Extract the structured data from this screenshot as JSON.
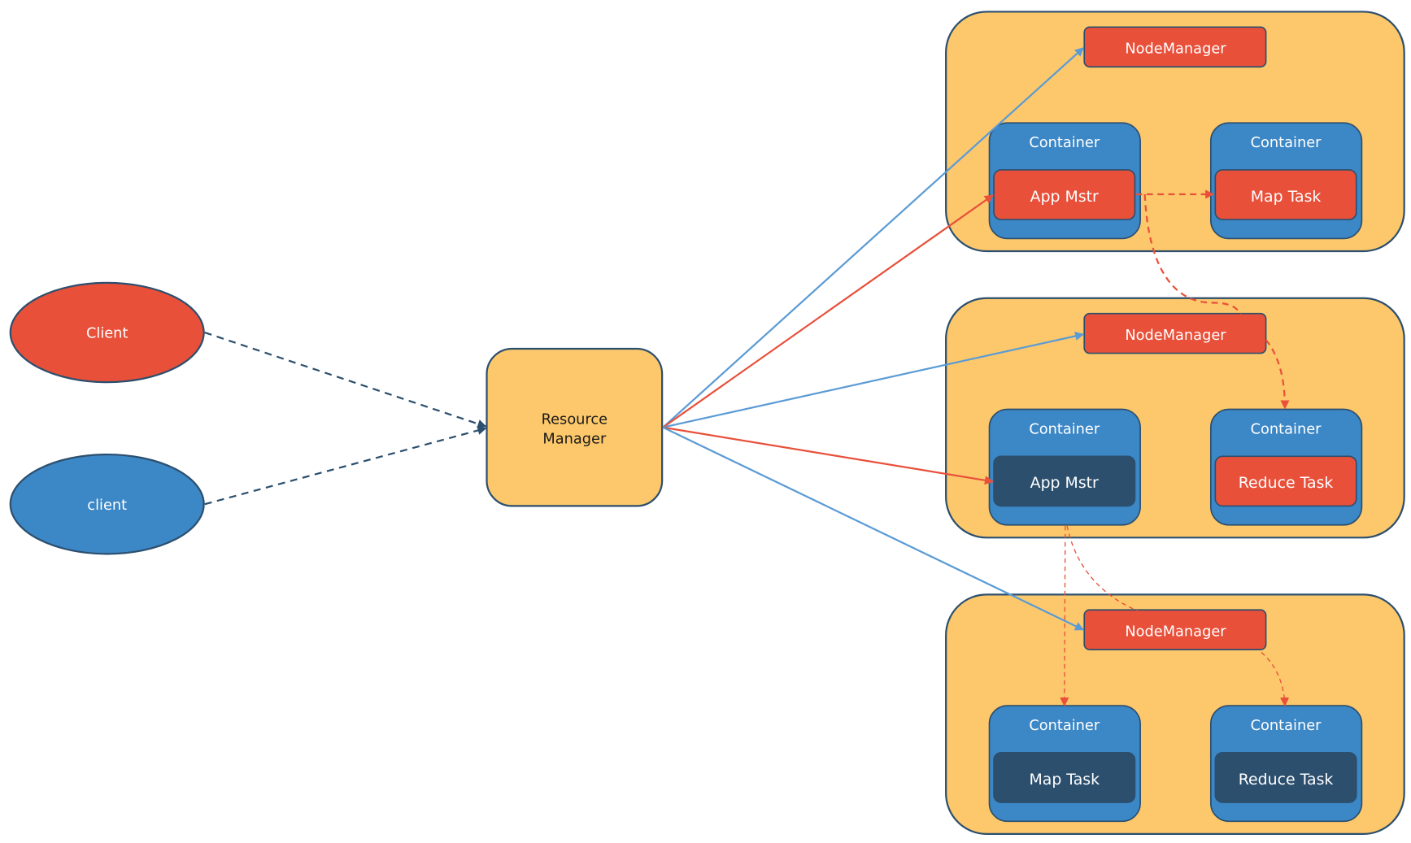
{
  "colors": {
    "node_bg": "#FCC86B",
    "container": "#3C87C6",
    "red": "#E8503A",
    "dark": "#2C4F6E",
    "border": "#2C4F6E",
    "blue_arrow": "#5B9BD5"
  },
  "clients": [
    {
      "label": "Client",
      "color": "#E8503A"
    },
    {
      "label": "client",
      "color": "#3C87C6"
    }
  ],
  "resource_manager": {
    "line1": "Resource",
    "line2": "Manager"
  },
  "nodes": [
    {
      "node_manager": "NodeManager",
      "containers": [
        {
          "title": "Container",
          "task": "App Mstr",
          "task_color": "#E8503A"
        },
        {
          "title": "Container",
          "task": "Map Task",
          "task_color": "#E8503A"
        }
      ]
    },
    {
      "node_manager": "NodeManager",
      "containers": [
        {
          "title": "Container",
          "task": "App Mstr",
          "task_color": "#2C4F6E"
        },
        {
          "title": "Container",
          "task": "Reduce Task",
          "task_color": "#E8503A"
        }
      ]
    },
    {
      "node_manager": "NodeManager",
      "containers": [
        {
          "title": "Container",
          "task": "Map Task",
          "task_color": "#2C4F6E"
        },
        {
          "title": "Container",
          "task": "Reduce Task",
          "task_color": "#2C4F6E"
        }
      ]
    }
  ]
}
